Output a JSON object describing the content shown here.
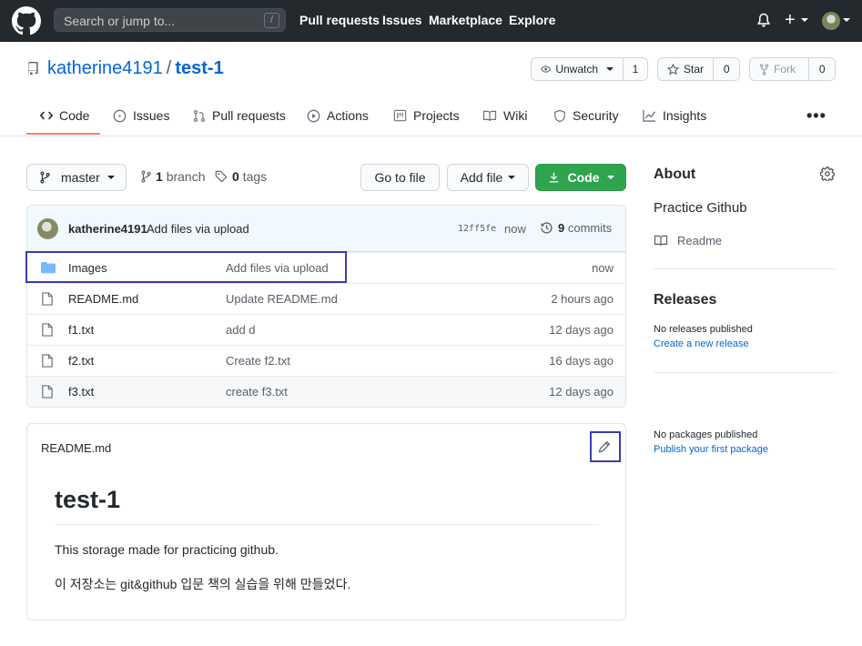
{
  "header": {
    "search_placeholder": "Search or jump to...",
    "search_shortcut": "/",
    "nav": [
      "Pull requests",
      "Issues",
      "Marketplace",
      "Explore"
    ],
    "plus": "+"
  },
  "repo": {
    "owner": "katherine4191",
    "separator": "/",
    "name": "test-1",
    "watch_label": "Unwatch",
    "watch_count": "1",
    "star_label": "Star",
    "star_count": "0",
    "fork_label": "Fork",
    "fork_count": "0"
  },
  "tabs": [
    {
      "label": "Code",
      "icon": "code-icon"
    },
    {
      "label": "Issues",
      "icon": "issue-icon"
    },
    {
      "label": "Pull requests",
      "icon": "pull-request-icon"
    },
    {
      "label": "Actions",
      "icon": "play-icon"
    },
    {
      "label": "Projects",
      "icon": "project-icon"
    },
    {
      "label": "Wiki",
      "icon": "book-icon"
    },
    {
      "label": "Security",
      "icon": "shield-icon"
    },
    {
      "label": "Insights",
      "icon": "graph-icon"
    }
  ],
  "more": "•••",
  "toolbar": {
    "branch": "master",
    "branch_count": "1",
    "branch_label": "branch",
    "tag_count": "0",
    "tag_label": "tags",
    "go_to_file": "Go to file",
    "add_file": "Add file",
    "code": "Code"
  },
  "commit": {
    "author": "katherine4191",
    "message": "Add files via upload",
    "sha": "12ff5fe",
    "time": "now",
    "count": "9",
    "count_label": "commits"
  },
  "files": [
    {
      "type": "folder",
      "name": "Images",
      "message": "Add files via upload",
      "time": "now"
    },
    {
      "type": "file",
      "name": "README.md",
      "message": "Update README.md",
      "time": "2 hours ago"
    },
    {
      "type": "file",
      "name": "f1.txt",
      "message": "add d",
      "time": "12 days ago"
    },
    {
      "type": "file",
      "name": "f2.txt",
      "message": "Create f2.txt",
      "time": "16 days ago"
    },
    {
      "type": "file",
      "name": "f3.txt",
      "message": "create f3.txt",
      "time": "12 days ago"
    }
  ],
  "readme": {
    "title": "README.md",
    "heading": "test-1",
    "line1": "This storage made for practicing github.",
    "line2": "이 저장소는 git&github 입문 책의 실습을 위해 만들었다."
  },
  "sidebar": {
    "about_title": "About",
    "description": "Practice Github",
    "readme_link": "Readme",
    "releases_title": "Releases",
    "no_releases": "No releases published",
    "create_release": "Create a new release",
    "no_packages": "No packages published",
    "publish_package": "Publish your first package"
  },
  "colors": {
    "header_bg": "#24292e",
    "link": "#0366d6",
    "green": "#2ea44f",
    "tab_underline": "#f9826c",
    "annotation_box": "#3c3cb4"
  }
}
